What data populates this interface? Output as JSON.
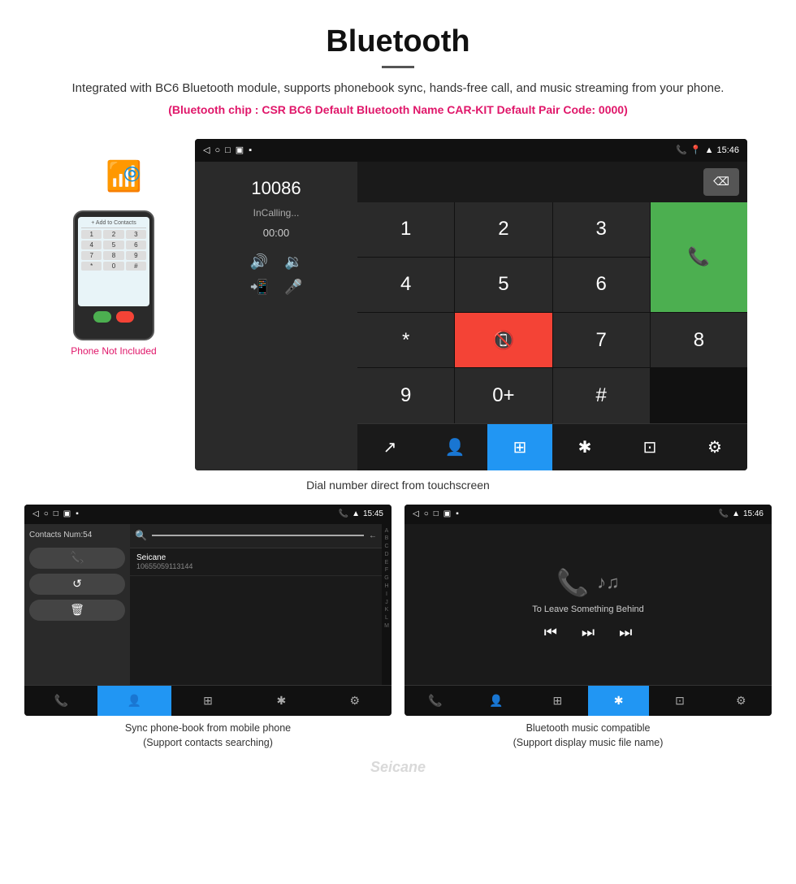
{
  "header": {
    "title": "Bluetooth",
    "description": "Integrated with BC6 Bluetooth module, supports phonebook sync, hands-free call, and music streaming from your phone.",
    "specs": "(Bluetooth chip : CSR BC6    Default Bluetooth Name CAR-KIT    Default Pair Code: 0000)"
  },
  "phone_label": "Phone Not Included",
  "dialer": {
    "status_time": "15:46",
    "number": "10086",
    "incalling": "InCalling...",
    "timer": "00:00",
    "keys": [
      "1",
      "2",
      "3",
      "*",
      "4",
      "5",
      "6",
      "0+",
      "7",
      "8",
      "9",
      "#"
    ],
    "caption": "Dial number direct from touchscreen"
  },
  "contacts_screen": {
    "status_time": "15:45",
    "contacts_num": "Contacts Num:54",
    "contact_name": "Seicane",
    "contact_number": "10655059113144",
    "alphabet": [
      "A",
      "B",
      "C",
      "D",
      "E",
      "F",
      "G",
      "H",
      "I",
      "J",
      "K",
      "L",
      "M"
    ],
    "caption_line1": "Sync phone-book from mobile phone",
    "caption_line2": "(Support contacts searching)"
  },
  "music_screen": {
    "status_time": "15:46",
    "song_name": "To Leave Something Behind",
    "caption_line1": "Bluetooth music compatible",
    "caption_line2": "(Support display music file name)"
  },
  "watermark": "Seicane"
}
